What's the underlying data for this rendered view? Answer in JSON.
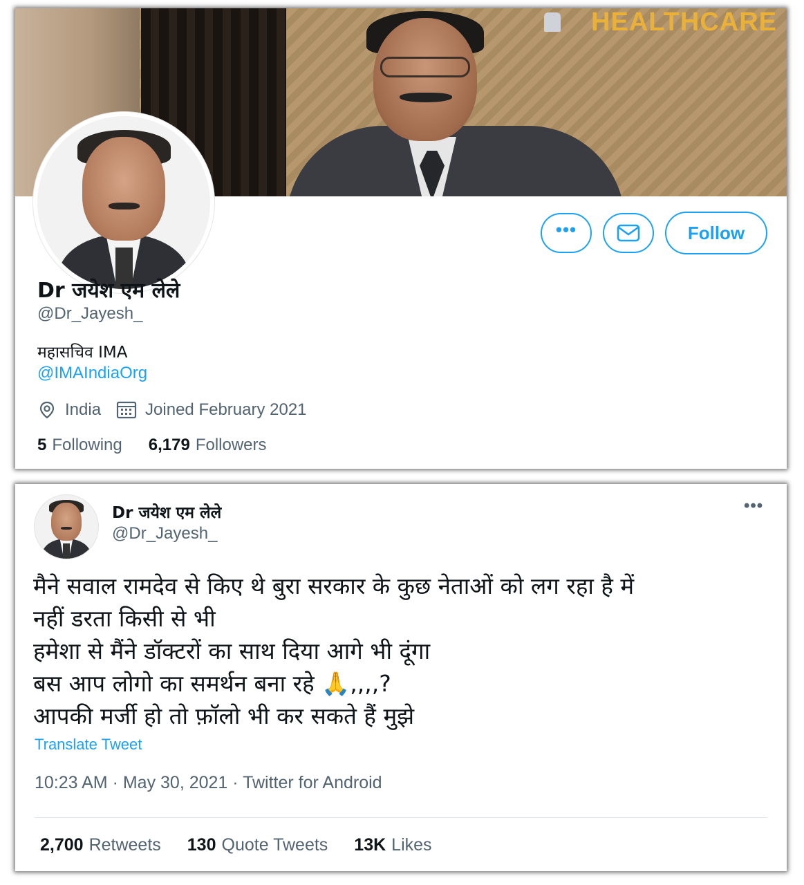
{
  "profile": {
    "banner_brand": "HEALTHCARE",
    "name": "Dr जयेश एम लेले",
    "handle": "@Dr_Jayesh_",
    "bio_line": "महासचिव IMA",
    "bio_link": "@IMAIndiaOrg",
    "location": "India",
    "joined": "Joined February 2021",
    "following_count": "5",
    "following_label": "Following",
    "followers_count": "6,179",
    "followers_label": "Followers",
    "more_label": "•••",
    "follow_label": "Follow",
    "icons": {
      "more": "more-icon",
      "message": "envelope-icon",
      "location": "location-pin-icon",
      "joined": "calendar-icon"
    }
  },
  "tweet": {
    "name": "Dr जयेश एम लेले",
    "handle": "@Dr_Jayesh_",
    "more_label": "•••",
    "lines": [
      "मैने सवाल रामदेव से किए थे बुरा सरकार के कुछ नेताओं को लग रहा है में",
      "नहीं डरता किसी से भी",
      "हमेशा से मैंने डॉक्टरों का साथ दिया आगे भी दूंगा",
      "बस आप लोगो का समर्थन बना रहे 🙏,,,,?",
      "आपकी मर्जी हो तो फ़ॉलो भी कर सकते हैं मुझे"
    ],
    "translate_label": "Translate Tweet",
    "meta": "10:23 AM · May 30, 2021 · Twitter for Android",
    "retweets_count": "2,700",
    "retweets_label": "Retweets",
    "quotes_count": "130",
    "quotes_label": "Quote Tweets",
    "likes_count": "13K",
    "likes_label": "Likes"
  },
  "colors": {
    "accent": "#1da1f2",
    "secondary_text": "#536471",
    "primary_text": "#0f1419"
  }
}
